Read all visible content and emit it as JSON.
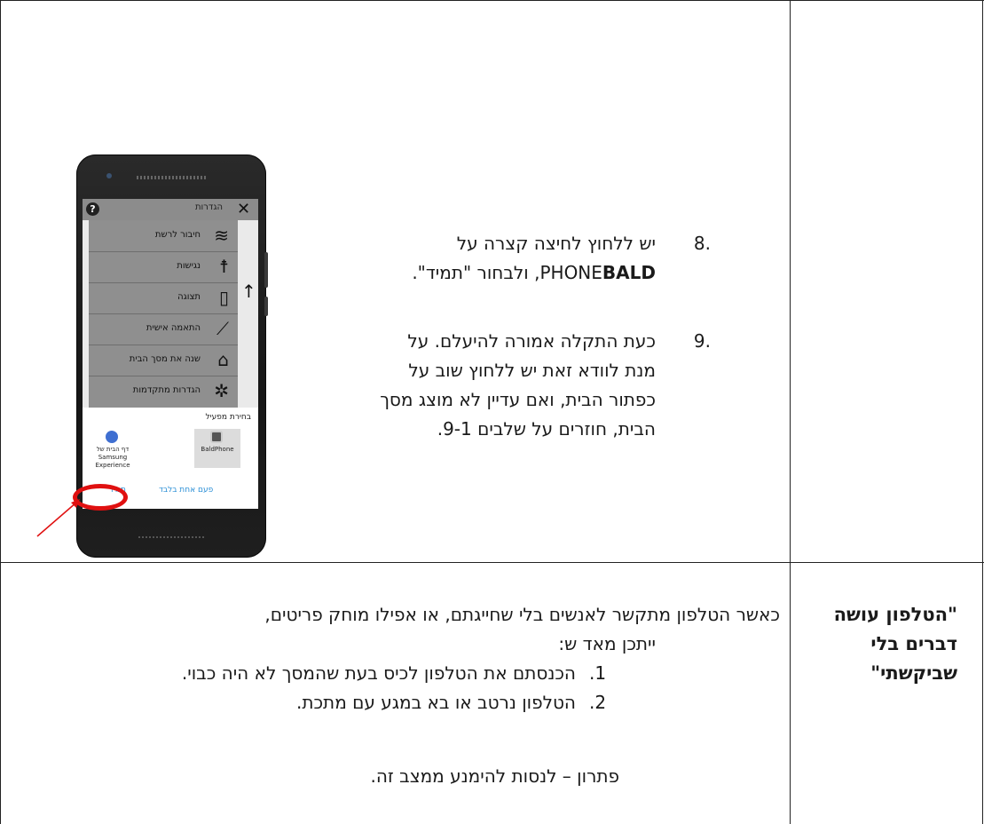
{
  "steps": [
    {
      "num": ".8",
      "lines_html_parts": [
        "יש ללחוץ לחיצה קצרה על",
        "PHONE",
        "BALD",
        ", ולבחור \"תמיד\"."
      ]
    },
    {
      "num": ".9",
      "lines": [
        "כעת התקלה אמורה להיעלם. על",
        "מנת לוודא זאת יש ללחוץ שוב על",
        "כפתור הבית, ואם עדיין לא מוצג מסך",
        "הבית,  חוזרים על שלבים 9-1."
      ]
    }
  ],
  "phone": {
    "header_title": "הגדרות",
    "close_glyph": "✕",
    "help_glyph": "?",
    "back_arrow": "↑",
    "menu_items": [
      {
        "label": "חיבור לרשת",
        "icon": "wifi-icon",
        "glyph": "≋"
      },
      {
        "label": "נגישות",
        "icon": "accessibility-icon",
        "glyph": "☨"
      },
      {
        "label": "תצוגה",
        "icon": "phone-icon",
        "glyph": "▯"
      },
      {
        "label": "התאמה אישית",
        "icon": "brush-icon",
        "glyph": "⟋"
      },
      {
        "label": "שנה את מסך הבית",
        "icon": "home-icon",
        "glyph": "⌂"
      },
      {
        "label": "הגדרות מתקדמות",
        "icon": "gear-icon",
        "glyph": "✲"
      }
    ],
    "chooser_title": "בחירת מפעיל",
    "apps": [
      {
        "name": "BaldPhone",
        "color": "#555555"
      },
      {
        "name": "דף הבית של Samsung Experience",
        "color": "#3f6fd1"
      }
    ],
    "option_always": "תמיד",
    "option_once": "פעם אחת בלבד"
  },
  "bottom": {
    "heading_lines": [
      "\"הטלפון עושה",
      "דברים בלי",
      "שביקשתי\""
    ],
    "intro_line1": "כאשר  הטלפון מתקשר לאנשים בלי שחייגתם, או אפילו מוחק פריטים,",
    "intro_line2": "ייתכן מאד ש:",
    "list": [
      {
        "num": ".1",
        "text": "הכנסתם את הטלפון לכיס בעת שהמסך לא היה כבוי."
      },
      {
        "num": ".2",
        "text": "הטלפון נרטב או בא במגע עם מתכת."
      }
    ],
    "solution": "פתרון – לנסות להימנע ממצב זה."
  },
  "colors": {
    "annotation_red": "#e01010",
    "link_blue": "#2b8fd6"
  }
}
